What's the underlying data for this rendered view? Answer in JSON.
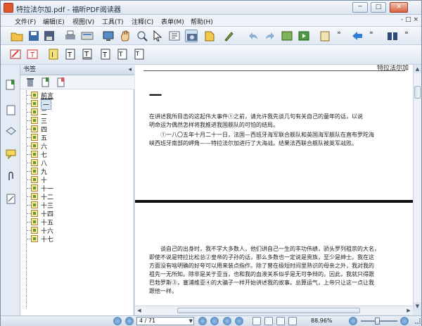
{
  "window": {
    "title": "特拉法尔加.pdf - 福昕PDF阅读器"
  },
  "menu": {
    "items": [
      "文件(F)",
      "编辑(E)",
      "视图(V)",
      "工具(T)",
      "注释(C)",
      "表单(M)",
      "帮助(H)"
    ],
    "mdi_controls": "- □ ×"
  },
  "toolbar": {
    "overflow": "»",
    "icons": [
      "open-folder-icon",
      "save-icon",
      "save-as-icon",
      "print-icon",
      "scan-icon",
      "fullscreen-icon",
      "hand-tool-icon",
      "zoom-icon",
      "select-icon",
      "text-select-icon",
      "snapshot-icon",
      "rtf-export-icon",
      "sign-icon",
      "undo-icon",
      "redo-icon",
      "image-icon",
      "media-icon",
      "clipboard-icon",
      "back-icon",
      "find-icon",
      "binoculars-icon"
    ]
  },
  "toolbar2": {
    "icons": [
      "typewriter-icon",
      "text-box-icon",
      "callout-icon",
      "strikeout-text-icon",
      "underline-text-icon",
      "replace-text-icon",
      "insert-text-icon",
      "text-size-icon"
    ]
  },
  "bookmarks": {
    "title": "书签",
    "collapse": "◂",
    "items": [
      "前言",
      "一",
      "二",
      "三",
      "四",
      "五",
      "六",
      "七",
      "八",
      "九",
      "十",
      "十一",
      "十二",
      "十三",
      "十四",
      "十五",
      "十六",
      "十七"
    ],
    "selected_index": 1
  },
  "document": {
    "running_head": "特拉法尔加",
    "chapter_heading": "一",
    "page1_lines": [
      "在讲述我所目击的这起伟大事件①之前，请允许我先谈几句有关自己的童年的话，以说",
      "明命运为偶然怎样将我推进我国舰队的可怕的结局。",
      "①一八〇五年十月二十一日，法国—西班牙海军联合舰队和英国海军舰队在直布罗陀海",
      "峡西班牙南部的岬角——特拉法尔加进行了大海战。结果法西联合舰队被英军战败。"
    ],
    "page2_lines": [
      "谈自己的出身时，我不学大多数人，他们讲自己一生的丰功伟绩，骄头罗列祖宗的大名，",
      "即使不说是特拉比松总②皇帝的子孙的话，那么多数也一定说是贵族，至少是绅士。我在这",
      "方面没有啥明确的好夸可以用来装点指作。除了曾在极短时间里熟识的母亲之外，我对我的",
      "祖先一无所知。除非是关于亚当，也和我的血液关系似乎是无可争辩的。因此，我就只得跟",
      "巴勃罗斯③，塞浦维亚④的大骗子一样开始讲述我的故事。总算运气，上帝只让这一点让我",
      "跟他一样。"
    ]
  },
  "status": {
    "page_indicator": "4 / 71",
    "zoom": "88.96%",
    "zoom_level": 0.45
  }
}
